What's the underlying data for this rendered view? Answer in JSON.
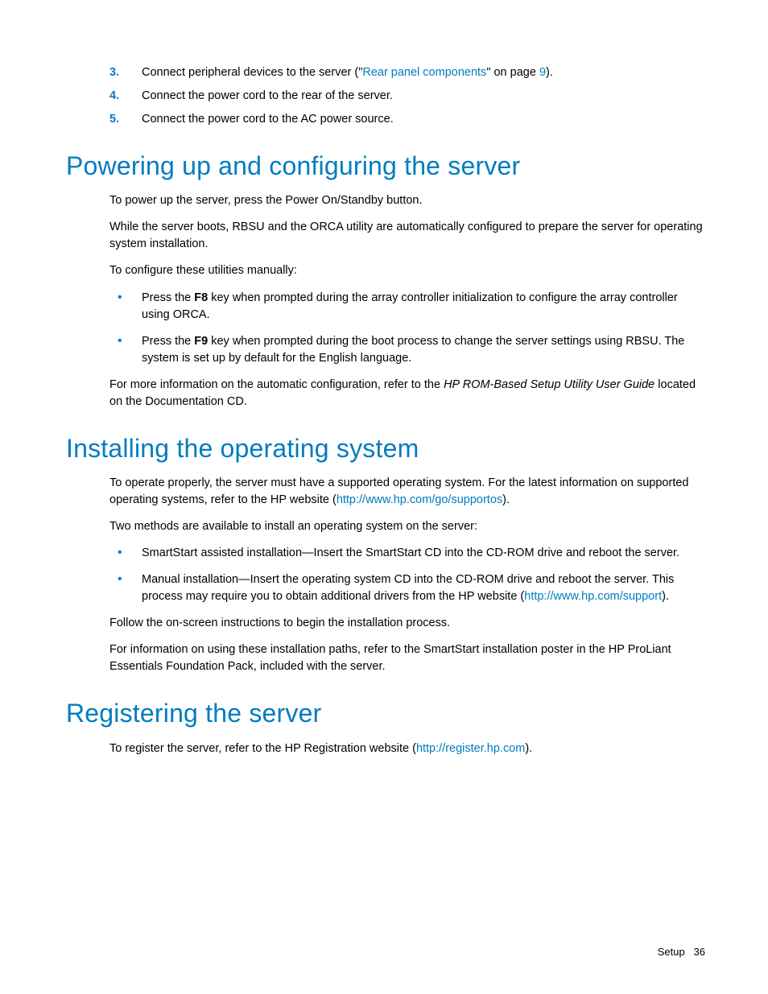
{
  "steps": {
    "s3_num": "3.",
    "s3_pre": "Connect peripheral devices to the server (\"",
    "s3_link": "Rear panel components",
    "s3_mid": "\" on page ",
    "s3_page": "9",
    "s3_post": ").",
    "s4_num": "4.",
    "s4_text": "Connect the power cord to the rear of the server.",
    "s5_num": "5.",
    "s5_text": "Connect the power cord to the AC power source."
  },
  "h1": "Powering up and configuring the server",
  "p1": "To power up the server, press the Power On/Standby button.",
  "p2": "While the server boots, RBSU and the ORCA utility are automatically configured to prepare the server for operating system installation.",
  "p3": "To configure these utilities manually:",
  "b1_pre": "Press the ",
  "b1_key": "F8",
  "b1_post": " key when prompted during the array controller initialization to configure the array controller using ORCA.",
  "b2_pre": "Press the ",
  "b2_key": "F9",
  "b2_post": " key when prompted during the boot process to change the server settings using RBSU. The system is set up by default for the English language.",
  "p4_pre": "For more information on the automatic configuration, refer to the ",
  "p4_italic": "HP ROM-Based Setup Utility User Guide",
  "p4_post": " located on the Documentation CD.",
  "h2": "Installing the operating system",
  "p5_pre": "To operate properly, the server must have a supported operating system. For the latest information on supported operating systems, refer to the HP website (",
  "p5_link": "http://www.hp.com/go/supportos",
  "p5_post": ").",
  "p6": "Two methods are available to install an operating system on the server:",
  "b3": "SmartStart assisted installation—Insert the SmartStart CD into the CD-ROM drive and reboot the server.",
  "b4_pre": "Manual installation—Insert the operating system CD into the CD-ROM drive and reboot the server. This process may require you to obtain additional drivers from the HP website (",
  "b4_link": "http://www.hp.com/support",
  "b4_post": ").",
  "p7": "Follow the on-screen instructions to begin the installation process.",
  "p8": "For information on using these installation paths, refer to the SmartStart installation poster in the HP ProLiant Essentials Foundation Pack, included with the server.",
  "h3": "Registering the server",
  "p9_pre": "To register the server, refer to the HP Registration website (",
  "p9_link": "http://register.hp.com",
  "p9_post": ").",
  "footer_section": "Setup",
  "footer_page": "36"
}
